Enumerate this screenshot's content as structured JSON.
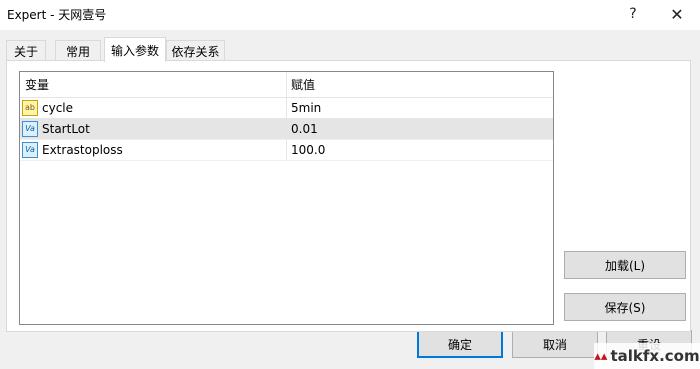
{
  "window": {
    "title": "Expert - 天网壹号",
    "help_glyph": "?",
    "close_glyph": "✕"
  },
  "tabs": [
    {
      "label": "关于"
    },
    {
      "label": "常用"
    },
    {
      "label": "输入参数",
      "active": true
    },
    {
      "label": "依存关系"
    }
  ],
  "grid": {
    "columns": {
      "variable": "变量",
      "value": "赋值"
    },
    "rows": [
      {
        "icon": "string-type-icon",
        "icon_text": "ab",
        "name": "cycle",
        "value": "5min",
        "selected": false
      },
      {
        "icon": "numeric-type-icon",
        "icon_text": "Va",
        "name": "StartLot",
        "value": "0.01",
        "selected": true
      },
      {
        "icon": "numeric-type-icon",
        "icon_text": "Va",
        "name": "Extrastoploss",
        "value": "100.0",
        "selected": false
      }
    ]
  },
  "side_buttons": {
    "load": "加载(L)",
    "save": "保存(S)"
  },
  "footer_buttons": {
    "ok": "确定",
    "cancel": "取消",
    "reset": "重设"
  },
  "watermark": {
    "text": "talkfx.com"
  },
  "colors": {
    "selected_row": "#e5e5e5",
    "default_button_border": "#0078d7",
    "dialog_bg": "#f0f0f0"
  }
}
